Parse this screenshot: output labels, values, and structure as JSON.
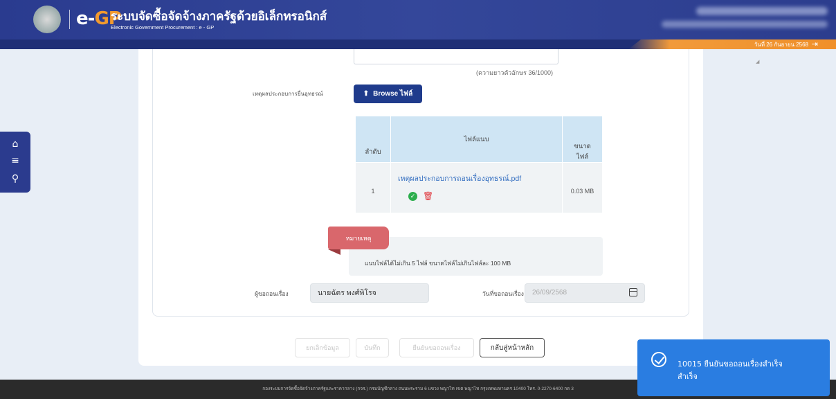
{
  "header": {
    "logo_text_e": "e-",
    "logo_text_gp": "GP",
    "title": "ระบบจัดซื้อจัดจ้างภาครัฐด้วยอิเล็กทรอนิกส์",
    "subtitle": "Electronic Government Procurement : e - GP",
    "date": "วันที่ 26 กันยายน 2568"
  },
  "form": {
    "char_count": "(ความยาวตัวอักษร 36/1000)",
    "reason_label": "เหตุผลประกอบการยื่นอุทธรณ์",
    "browse_label": "Browse ไฟล์",
    "table": {
      "headers": [
        "ลำดับ",
        "ไฟล์แนบ",
        "ขนาด\nไฟล์"
      ],
      "rows": [
        {
          "no": "1",
          "file": "เหตุผลประกอบการถอนเรื่องอุทธรณ์.pdf",
          "size": "0.03 MB"
        }
      ]
    },
    "remark_tag": "หมายเหตุ",
    "remark_text": "แนบไฟล์ได้ไม่เกิน 5 ไฟล์ ขนาดไฟล์ไม่เกินไฟล์ละ 100 MB",
    "requester_label": "ผู้ขอถอนเรื่อง",
    "requester_value": "นายฉัตร พงศ์พิโรจ",
    "date_label": "วันที่ขอถอนเรื่อง",
    "date_value": "26/09/2568"
  },
  "buttons": {
    "cancel": "ยกเลิกข้อมูล",
    "save": "บันทึก",
    "confirm": "ยืนยันขอถอนเรื่อง",
    "back": "กลับสู่หน้าหลัก"
  },
  "footer": {
    "text": "กองระบบการจัดซื้อจัดจ้างภาครัฐและราคากลาง (กจร.) กรมบัญชีกลาง ถนนพระราม 6 แขวง พญาไท เขต พญาไท กรุงเทพมหานคร 10400 โทร. 0-2270-6400 กด 3"
  },
  "toast": {
    "line1": "10015 ยืนยันขอถอนเรื่องสำเร็จ",
    "line2": "สำเร็จ"
  }
}
